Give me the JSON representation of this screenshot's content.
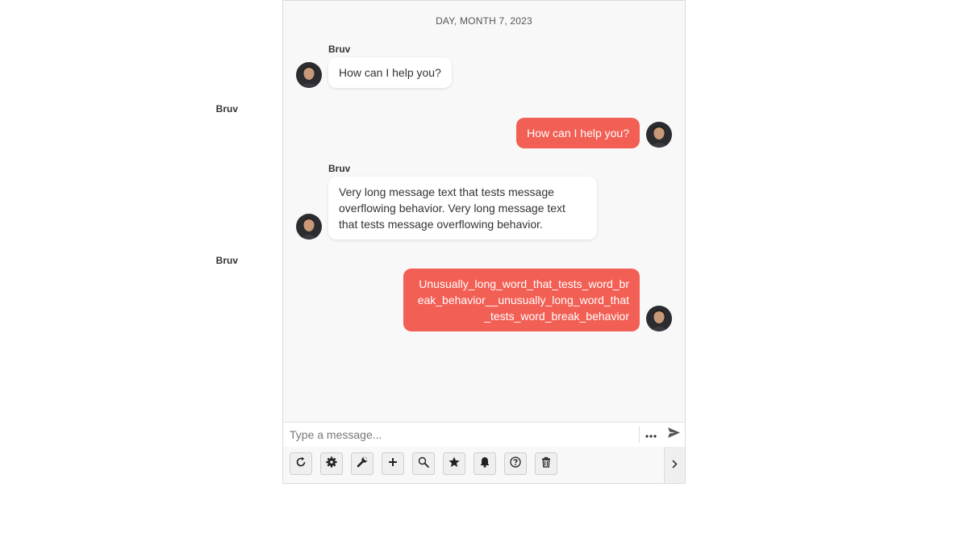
{
  "date_divider": "DAY, MONTH 7, 2023",
  "messages": [
    {
      "author": "Bruv",
      "direction": "incoming",
      "text": "How can I help you?"
    },
    {
      "author": "Bruv",
      "direction": "outgoing",
      "text": "How can I help you?"
    },
    {
      "author": "Bruv",
      "direction": "incoming",
      "text": "Very long message text that tests message overflowing behavior. Very long message text that tests message overflowing behavior."
    },
    {
      "author": "Bruv",
      "direction": "outgoing",
      "text": "Unusually_long_word_that_tests_word_break_behavior__unusually_long_word_that_tests_word_break_behavior"
    }
  ],
  "composer": {
    "placeholder": "Type a message...",
    "value": "",
    "more_icon": "ellipsis-icon",
    "send_icon": "send-icon"
  },
  "toolbar": {
    "buttons": [
      {
        "icon": "refresh-icon"
      },
      {
        "icon": "gear-icon"
      },
      {
        "icon": "wrench-icon"
      },
      {
        "icon": "plus-icon"
      },
      {
        "icon": "search-icon"
      },
      {
        "icon": "star-icon"
      },
      {
        "icon": "bell-icon"
      },
      {
        "icon": "help-icon"
      },
      {
        "icon": "trash-icon"
      }
    ],
    "expand_icon": "chevron-right-icon"
  },
  "colors": {
    "outgoing_bubble": "#f25f54",
    "incoming_bubble": "#ffffff",
    "background": "#f8f8f8"
  }
}
